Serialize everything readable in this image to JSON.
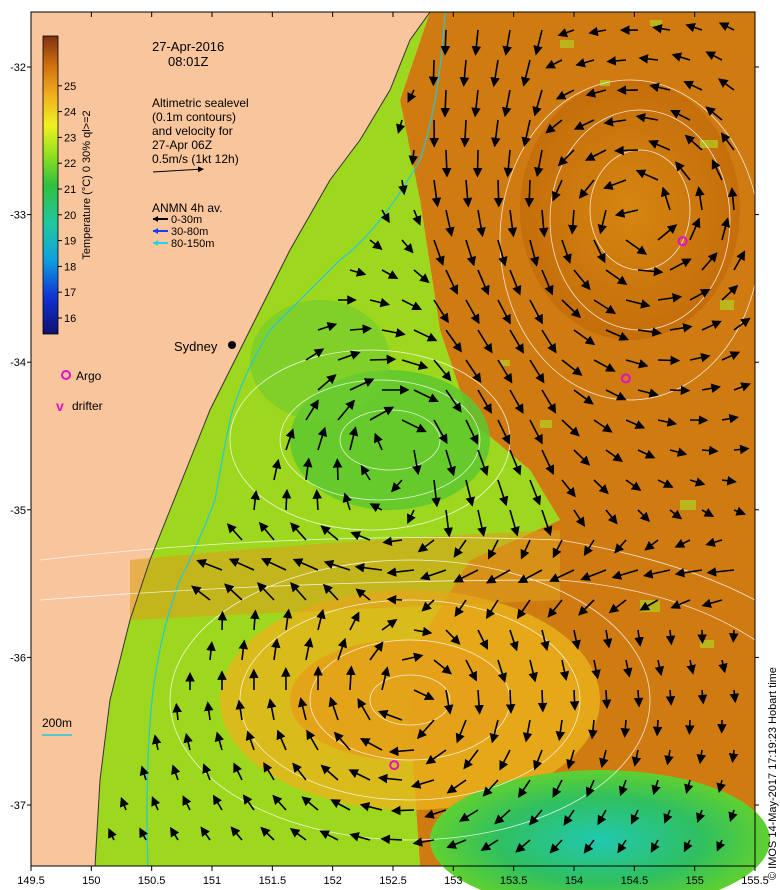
{
  "header": {
    "date": "27-Apr-2016",
    "time": "08:01Z"
  },
  "altimetry": {
    "lines": [
      "Altimetric sealevel",
      "(0.1m contours)",
      "and velocity for",
      "27-Apr 06Z",
      "0.5m/s (1kt 12h)"
    ]
  },
  "anmn": {
    "title": "ANMN 4h av.",
    "items": [
      {
        "label": "0-30m",
        "color": "#000000"
      },
      {
        "label": "30-80m",
        "color": "#1a3cff"
      },
      {
        "label": "80-150m",
        "color": "#22d6e0"
      }
    ]
  },
  "colorbar": {
    "label": "Temperature (°C) 0 30% ql>=2",
    "ticks": [
      "16",
      "17",
      "18",
      "19",
      "20",
      "21",
      "22",
      "23",
      "24",
      "25"
    ]
  },
  "city": "Sydney",
  "legend": {
    "argo": "Argo",
    "drifter_symbol": "v",
    "drifter": "drifter"
  },
  "depth_label": "200m",
  "credit": "© IMOS 14-May-2017 17:19:23 Hobart time",
  "axes": {
    "x_ticks": [
      "149.5",
      "150",
      "150.5",
      "151",
      "151.5",
      "152",
      "152.5",
      "153",
      "153.5",
      "154",
      "154.5",
      "155",
      "155.5"
    ],
    "y_ticks": [
      "-32",
      "-33",
      "-34",
      "-35",
      "-36",
      "-37"
    ]
  },
  "colors": {
    "land": "#f9c59c",
    "argo": "#e010c8",
    "isobath": "#22c8d8",
    "contour": "#ffffff"
  },
  "argo_floats": [
    {
      "lon": 154.9,
      "lat": -33.18
    },
    {
      "lon": 154.43,
      "lat": -34.11
    },
    {
      "lon": 152.51,
      "lat": -36.73
    }
  ]
}
